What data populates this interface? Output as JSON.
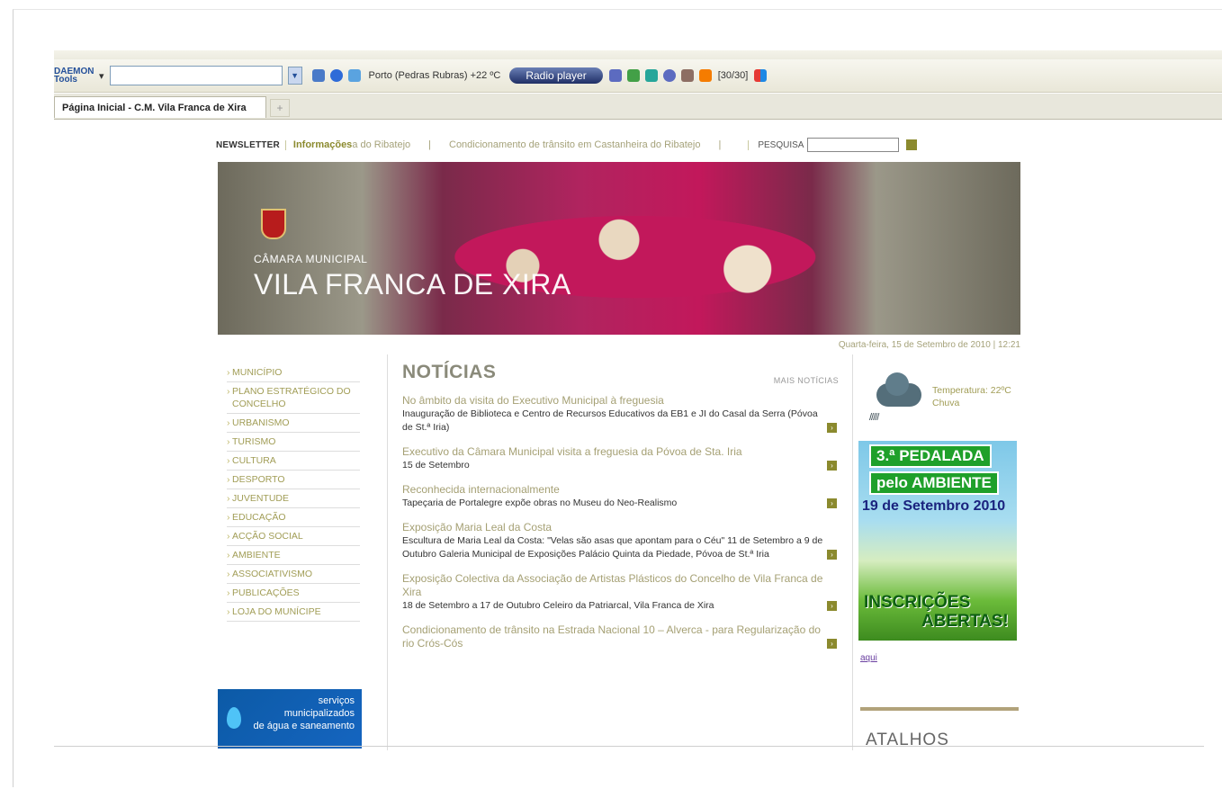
{
  "browser": {
    "toolbar": {
      "daemon_label": "DAEMON Tools",
      "weather_text": "Porto (Pedras Rubras) +22 ºC",
      "radio_label": "Radio player",
      "counter": "[30/30]"
    },
    "tab_title": "Página Inicial - C.M. Vila Franca de Xira",
    "new_tab": "+"
  },
  "topbar": {
    "newsletter": "NEWSLETTER",
    "info_label": "Informações",
    "ticker_1": "a do Ribatejo",
    "ticker_2": "Condicionamento de trânsito em Castanheira do Ribatejo",
    "separator": "|",
    "search_label": "PESQUISA"
  },
  "banner": {
    "subtitle": "CÂMARA MUNICIPAL",
    "title": "VILA FRANCA DE XIRA"
  },
  "date_text": "Quarta-feira, 15 de Setembro de 2010 | 12:21",
  "sidebar": {
    "items": [
      "MUNICÍPIO",
      "PLANO ESTRATÉGICO DO CONCELHO",
      "URBANISMO",
      "TURISMO",
      "CULTURA",
      "DESPORTO",
      "JUVENTUDE",
      "EDUCAÇÃO",
      "ACÇÃO SOCIAL",
      "AMBIENTE",
      "ASSOCIATIVISMO",
      "PUBLICAÇÕES",
      "LOJA DO MUNÍCIPE"
    ],
    "promo": {
      "line1": "serviços",
      "line2": "municipalizados",
      "line3": "de água e saneamento"
    }
  },
  "news": {
    "title": "NOTÍCIAS",
    "more": "MAIS NOTÍCIAS",
    "items": [
      {
        "title": "No âmbito da visita do Executivo Municipal à freguesia",
        "sub": "Inauguração de Biblioteca e Centro de Recursos Educativos da EB1 e JI do Casal da Serra (Póvoa de St.ª Iria)"
      },
      {
        "title": "Executivo da Câmara Municipal visita a freguesia da Póvoa de Sta. Iria",
        "sub": "15 de Setembro"
      },
      {
        "title": "Reconhecida internacionalmente",
        "sub": "Tapeçaria de Portalegre expõe obras no Museu do Neo-Realismo"
      },
      {
        "title": "Exposição Maria Leal da Costa",
        "sub": "Escultura de Maria Leal da Costa: \"Velas são asas que apontam para o Céu\" 11 de Setembro a 9 de Outubro Galeria Municipal de Exposições Palácio Quinta da Piedade, Póvoa de St.ª Iria"
      },
      {
        "title": "Exposição Colectiva da Associação de Artistas Plásticos do Concelho de Vila Franca de Xira",
        "sub": "18 de Setembro a 17 de Outubro Celeiro da Patriarcal, Vila Franca de Xira"
      },
      {
        "title": "Condicionamento de trânsito na Estrada Nacional 10 – Alverca - para Regularização do rio Crós-Cós",
        "sub": ""
      }
    ]
  },
  "weather": {
    "temperature": "Temperatura: 22ºC",
    "condition": "Chuva"
  },
  "ad": {
    "line1": "3.ª PEDALADA",
    "line2": "pelo AMBIENTE",
    "line3": "19 de Setembro 2010",
    "line4": "INSCRIÇÕES",
    "line5": "ABERTAS!"
  },
  "aqui": "aqui",
  "atalhos": "ATALHOS"
}
